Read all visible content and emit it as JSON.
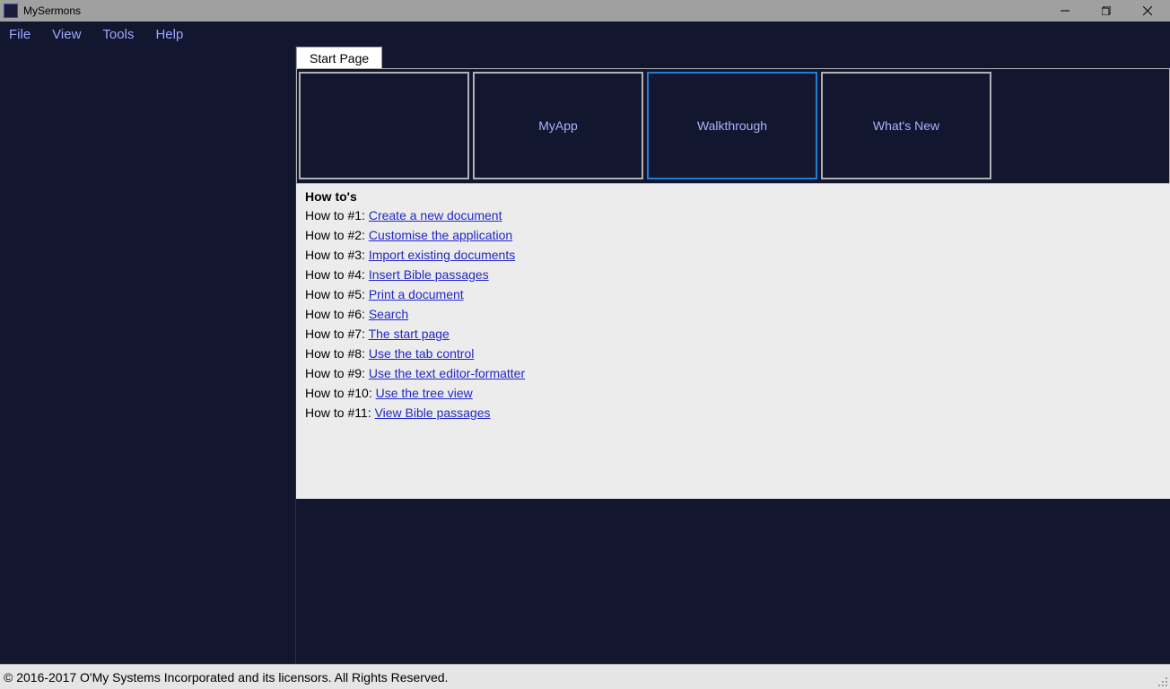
{
  "window": {
    "title": "MySermons"
  },
  "menu": {
    "items": [
      "File",
      "View",
      "Tools",
      "Help"
    ]
  },
  "tab": {
    "label": "Start Page"
  },
  "cards": [
    {
      "label": "",
      "selected": false
    },
    {
      "label": "MyApp",
      "selected": false
    },
    {
      "label": "Walkthrough",
      "selected": true
    },
    {
      "label": "What's New",
      "selected": false
    }
  ],
  "howto": {
    "header": "How to's",
    "items": [
      {
        "label": "How to #1: ",
        "link": "Create a new document"
      },
      {
        "label": "How to #2: ",
        "link": "Customise the application"
      },
      {
        "label": "How to #3: ",
        "link": "Import existing documents"
      },
      {
        "label": "How to #4: ",
        "link": "Insert Bible passages"
      },
      {
        "label": "How to #5: ",
        "link": "Print a document"
      },
      {
        "label": "How to #6: ",
        "link": "Search"
      },
      {
        "label": "How to #7: ",
        "link": "The start page"
      },
      {
        "label": "How to #8: ",
        "link": "Use the tab control"
      },
      {
        "label": "How to #9: ",
        "link": "Use the text editor-formatter"
      },
      {
        "label": "How to #10: ",
        "link": "Use the tree view"
      },
      {
        "label": "How to #11: ",
        "link": "View Bible passages"
      }
    ]
  },
  "footer": {
    "text": "© 2016-2017 O'My Systems Incorporated and its licensors. All Rights Reserved."
  }
}
